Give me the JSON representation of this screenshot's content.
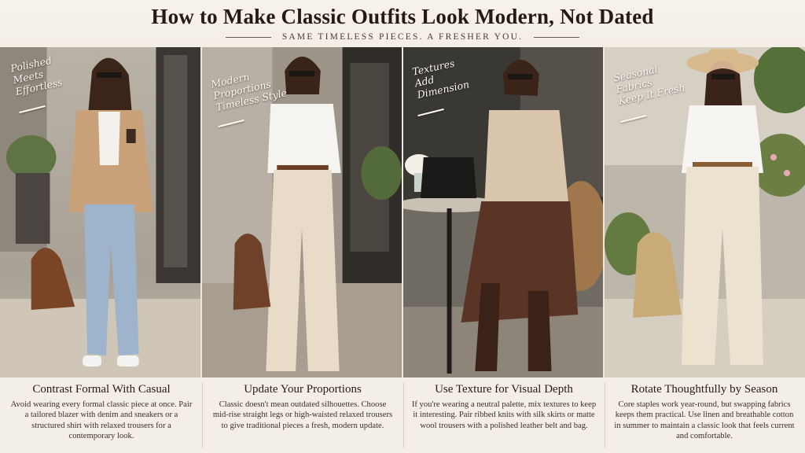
{
  "header": {
    "title": "How to Make Classic Outfits Look Modern, Not Dated",
    "subtitle": "SAME TIMELESS PIECES. A FRESHER YOU."
  },
  "panels": [
    {
      "script": "Polished\nMeets\nEffortless",
      "caption_title": "Contrast Formal With Casual",
      "caption_body": "Avoid wearing every formal classic piece at once. Pair a tailored blazer with denim and sneakers or a structured shirt with relaxed trousers for a contemporary look."
    },
    {
      "script": "Modern\nProportions\nTimeless Style",
      "caption_title": "Update Your Proportions",
      "caption_body": "Classic doesn't mean outdated silhouettes. Choose mid-rise straight legs or high-waisted relaxed trousers to give traditional pieces a fresh, modern update."
    },
    {
      "script": "Textures\nAdd\nDimension",
      "caption_title": "Use Texture for Visual Depth",
      "caption_body": "If you're wearing a neutral palette, mix textures to keep it interesting. Pair ribbed knits with silk skirts or matte wool trousers with a polished leather belt and bag."
    },
    {
      "script": "Seasonal\nFabrics\nKeep It Fresh",
      "caption_title": "Rotate Thoughtfully by Season",
      "caption_body": "Core staples work year-round, but swapping fabrics keeps them practical. Use linen and breathable cotton in summer to maintain a classic look that feels current and comfortable."
    }
  ],
  "colors": {
    "background": "#f3eee6",
    "camel": "#c9a27a",
    "denim": "#9db4cc",
    "cream": "#e8dcc8",
    "leather": "#6b3e26",
    "text": "#241c15"
  }
}
